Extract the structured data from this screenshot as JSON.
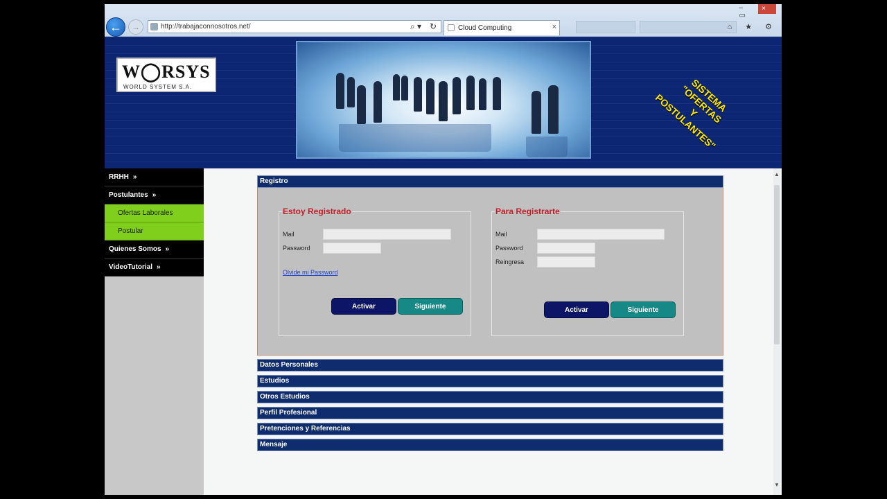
{
  "browser": {
    "url": "http://trabajaconnosotros.net/",
    "tab_title": "Cloud Computing",
    "back_symbol": "←",
    "forward_symbol": "→",
    "search_icon": "⌕ ▾",
    "refresh_icon": "↻",
    "tab_close": "×",
    "window_controls": "– ▭",
    "window_close": "×",
    "toolbar_icons": "⌂ ★ ⚙"
  },
  "header": {
    "logo_main": "W◯RSYS",
    "logo_sub": "WORLD SYSTEM S.A.",
    "slogan_line1": "SISTEMA",
    "slogan_line2": "\"OFERTAS",
    "slogan_line3": "Y",
    "slogan_line4": "POSTULANTES\""
  },
  "sidebar": {
    "items": [
      {
        "label": "RRHH",
        "chev": "»"
      },
      {
        "label": "Postulantes",
        "chev": "»"
      },
      {
        "label": "Ofertas Laborales"
      },
      {
        "label": "Postular"
      },
      {
        "label": "Quienes Somos",
        "chev": "»"
      },
      {
        "label": "VideoTutorial",
        "chev": "»"
      }
    ]
  },
  "registro": {
    "header": "Registro",
    "registered": {
      "legend": "Estoy Registrado",
      "mail_label": "Mail",
      "password_label": "Password",
      "mail_value": "",
      "password_value": "",
      "forgot": "Olvide mi Password",
      "activar": "Activar",
      "siguiente": "Siguiente"
    },
    "register": {
      "legend": "Para Registrarte",
      "mail_label": "Mail",
      "password_label": "Password",
      "reingresa_label": "Reingresa",
      "mail_value": "",
      "password_value": "",
      "reingresa_value": "",
      "activar": "Activar",
      "siguiente": "Siguiente"
    }
  },
  "sections": [
    "Datos Personales",
    "Estudios",
    "Otros Estudios",
    "Perfil Profesional",
    "Pretenciones y Referencias",
    "Mensaje"
  ],
  "scrollbar": {
    "up": "▲",
    "down": "▼"
  },
  "colors": {
    "header_bg": "#0d2673",
    "menu_bg": "#000000",
    "submenu_bg": "#7fcf1c",
    "panel_head": "#0e2c6e",
    "legend_red": "#c0202a",
    "btn_dark": "#0c1566",
    "btn_teal": "#168986",
    "slogan_yellow": "#ffe800"
  }
}
